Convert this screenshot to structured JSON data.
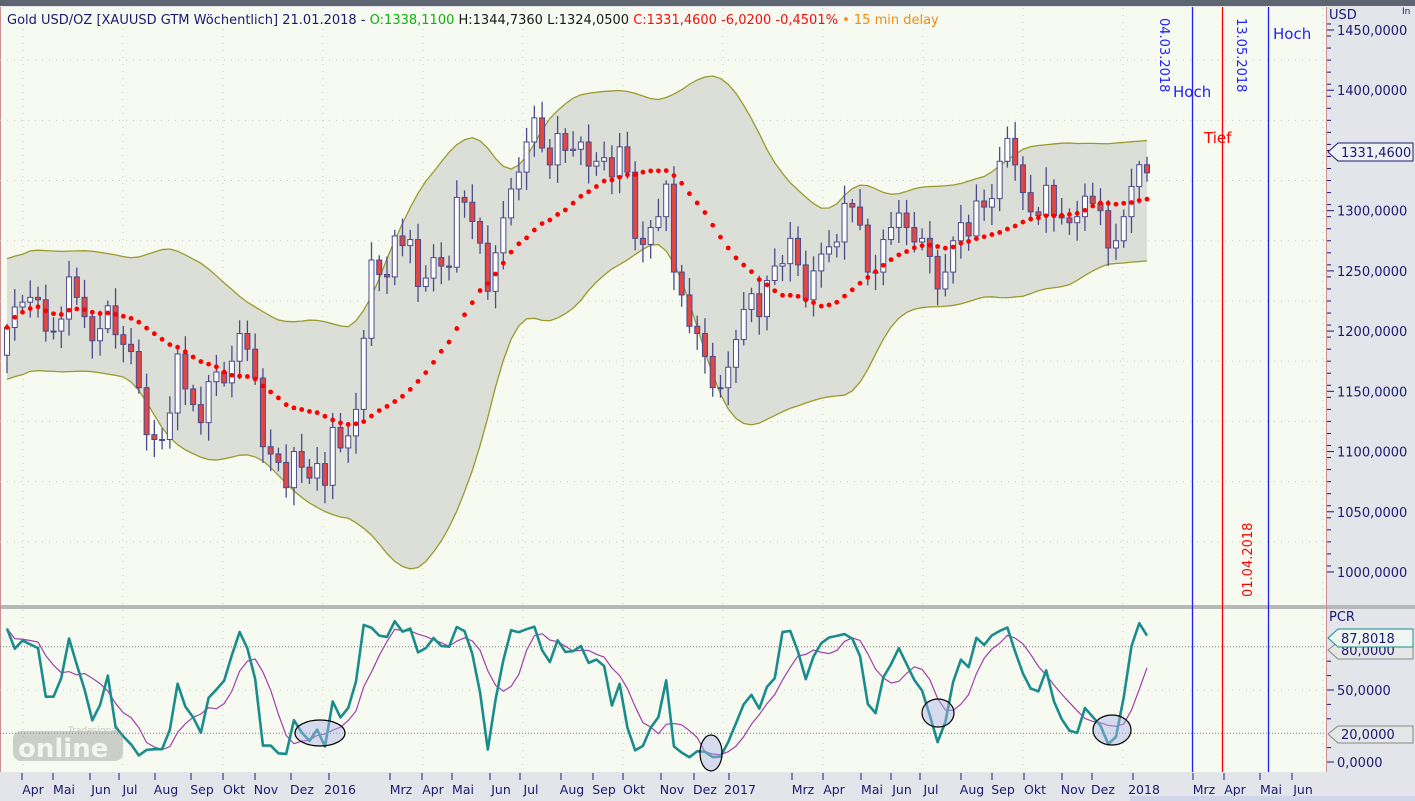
{
  "header": {
    "instrument": "Gold USD/OZ [XAUUSD GTM Wöchentlich]",
    "date": "21.01.2018",
    "sep": "-",
    "open": "O:1338,1100",
    "high": "H:1344,7360",
    "low": "L:1324,0500",
    "close": "C:1331,4600",
    "change": "-6,0200",
    "change_pct": "-0,4501%",
    "delay_dot": "•",
    "delay": "15 min delay",
    "corner": "In"
  },
  "price_axis": {
    "unit": "USD",
    "ticks": [
      "1450,0000",
      "1400,0000",
      "1350,0000",
      "1300,0000",
      "1250,0000",
      "1200,0000",
      "1150,0000",
      "1100,0000",
      "1050,0000",
      "1000,0000"
    ],
    "tick_values": [
      1450,
      1400,
      1350,
      1300,
      1250,
      1200,
      1150,
      1100,
      1050,
      1000
    ],
    "last_tag": "1331,4600",
    "last_value": 1331.46
  },
  "pcr_axis": {
    "unit": "PCR",
    "ticks": [
      "50,0000",
      "0,0000"
    ],
    "tick_values": [
      50,
      0
    ],
    "tag_current": "87,8018",
    "tag_upper": "80,0000",
    "tag_lower": "20,0000",
    "upper_level": 80,
    "lower_level": 20
  },
  "x_axis": {
    "labels": [
      "Apr",
      "Mai",
      "Jun",
      "Jul",
      "Aug",
      "Sep",
      "Okt",
      "Nov",
      "Dez",
      "2016",
      "Mrz",
      "Apr",
      "Mai",
      "Jun",
      "Jul",
      "Aug",
      "Sep",
      "Okt",
      "Nov",
      "Dez",
      "2017",
      "Mrz",
      "Apr",
      "Mai",
      "Jun",
      "Jul",
      "Aug",
      "Sep",
      "Okt",
      "Nov",
      "Dez",
      "2018",
      "Mrz",
      "Apr",
      "Mai",
      "Jun"
    ]
  },
  "annotations": {
    "line1_date": "04.03.2018",
    "line1_label": "Hoch",
    "line2_date_top": "13.05.2018",
    "line2_date_bottom": "01.04.2018",
    "line2_label": "Tief",
    "line3_label": "Hoch",
    "colors": {
      "hoch": "#2020ff",
      "tief": "#ff0000"
    }
  },
  "watermark": {
    "brand": "Tradesignal",
    "text": "online"
  },
  "chart_data": {
    "type": "candlestick",
    "title": "Gold USD/OZ [XAUUSD GTM Wöchentlich]",
    "interval": "weekly",
    "ylabel": "USD",
    "ylim": [
      980,
      1460
    ],
    "first_open": 1180,
    "closes": [
      1203,
      1220,
      1224,
      1228,
      1226,
      1200,
      1200,
      1210,
      1245,
      1228,
      1212,
      1192,
      1202,
      1221,
      1197,
      1189,
      1183,
      1153,
      1114,
      1110,
      1110,
      1132,
      1181,
      1152,
      1139,
      1124,
      1158,
      1166,
      1157,
      1175,
      1198,
      1185,
      1161,
      1104,
      1098,
      1091,
      1070,
      1100,
      1087,
      1078,
      1090,
      1072,
      1120,
      1103,
      1113,
      1135,
      1194,
      1259,
      1247,
      1245,
      1279,
      1271,
      1276,
      1237,
      1244,
      1261,
      1254,
      1253,
      1311,
      1307,
      1291,
      1273,
      1233,
      1265,
      1294,
      1318,
      1332,
      1357,
      1377,
      1352,
      1338,
      1364,
      1350,
      1351,
      1357,
      1337,
      1341,
      1344,
      1328,
      1353,
      1332,
      1277,
      1272,
      1286,
      1295,
      1322,
      1249,
      1230,
      1204,
      1198,
      1179,
      1153,
      1153,
      1170,
      1193,
      1218,
      1231,
      1212,
      1242,
      1254,
      1256,
      1277,
      1255,
      1226,
      1250,
      1264,
      1270,
      1274,
      1306,
      1303,
      1288,
      1249,
      1249,
      1276,
      1286,
      1298,
      1286,
      1274,
      1277,
      1262,
      1235,
      1249,
      1275,
      1290,
      1279,
      1308,
      1303,
      1310,
      1341,
      1360,
      1338,
      1315,
      1299,
      1296,
      1321,
      1296,
      1294,
      1290,
      1295,
      1312,
      1306,
      1300,
      1269,
      1275,
      1295,
      1320,
      1338.11,
      1331.46
    ],
    "last_bar": {
      "open": 1338.11,
      "high": 1344.736,
      "low": 1324.05,
      "close": 1331.46
    },
    "overlays": [
      "Bollinger Bands (20, 2)",
      "SMA 20 (red dots)"
    ],
    "indicator": {
      "name": "PCR",
      "ylim": [
        0,
        100
      ],
      "levels": [
        20,
        80
      ],
      "current": 87.8018,
      "period": 14,
      "signal_period": 5
    },
    "colors": {
      "up_body": "#ffffff",
      "down_body": "#e04848",
      "outline": "#4a4a8a",
      "band_fill": "#dcdfd8",
      "band_line": "#9a9a2a",
      "sma": "#ff0000",
      "pcr": "#1a8c8c",
      "signal": "#a040a8"
    }
  }
}
